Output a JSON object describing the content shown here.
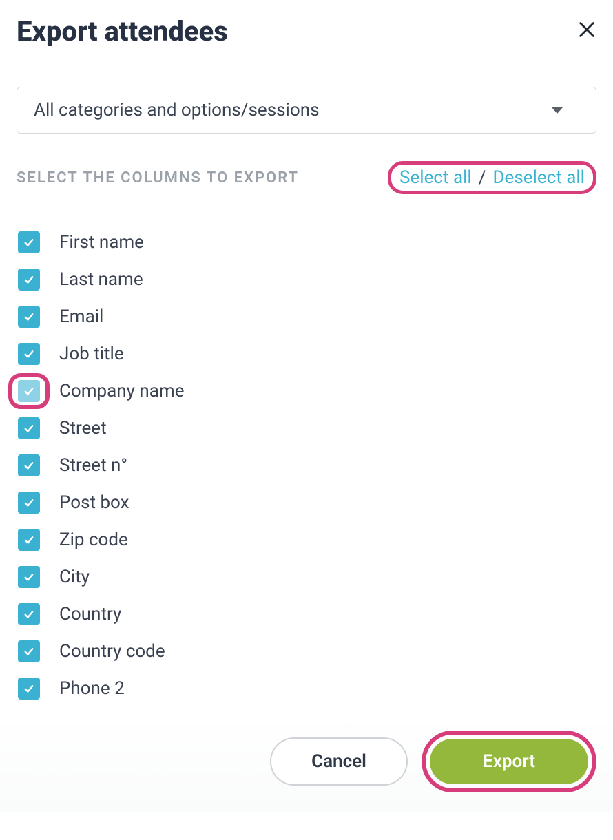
{
  "header": {
    "title": "Export attendees"
  },
  "filter": {
    "selected": "All categories and options/sessions"
  },
  "section": {
    "title": "SELECT THE COLUMNS TO EXPORT",
    "select_all": "Select all",
    "separator": "/",
    "deselect_all": "Deselect all"
  },
  "columns": [
    {
      "label": "First name",
      "checked": true,
      "highlighted": false
    },
    {
      "label": "Last name",
      "checked": true,
      "highlighted": false
    },
    {
      "label": "Email",
      "checked": true,
      "highlighted": false
    },
    {
      "label": "Job title",
      "checked": true,
      "highlighted": false
    },
    {
      "label": "Company name",
      "checked": true,
      "highlighted": true
    },
    {
      "label": "Street",
      "checked": true,
      "highlighted": false
    },
    {
      "label": "Street n°",
      "checked": true,
      "highlighted": false
    },
    {
      "label": "Post box",
      "checked": true,
      "highlighted": false
    },
    {
      "label": "Zip code",
      "checked": true,
      "highlighted": false
    },
    {
      "label": "City",
      "checked": true,
      "highlighted": false
    },
    {
      "label": "Country",
      "checked": true,
      "highlighted": false
    },
    {
      "label": "Country code",
      "checked": true,
      "highlighted": false
    },
    {
      "label": "Phone 2",
      "checked": true,
      "highlighted": false
    }
  ],
  "footer": {
    "cancel": "Cancel",
    "export": "Export"
  }
}
